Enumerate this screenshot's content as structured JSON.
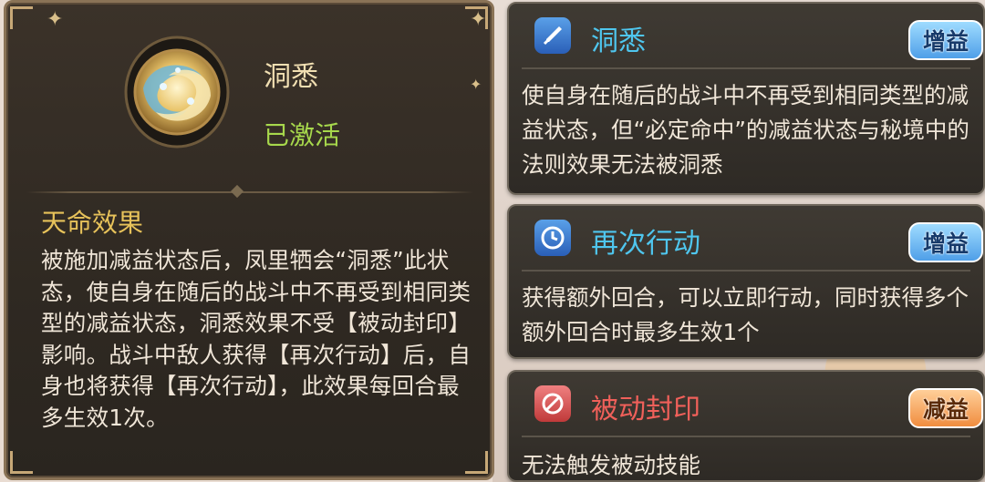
{
  "skill": {
    "name": "洞悉",
    "status": "已激活",
    "effect_title": "天命效果",
    "effect_text": "被施加减益状态后，凤里牺会“洞悉”此状态，使自身在随后的战斗中不再受到相同类型的减益状态，洞悉效果不受【被动封印】影响。战斗中敌人获得【再次行动】后，自身也将获得【再次行动】，此效果每回合最多生效1次。"
  },
  "cards": [
    {
      "name": "洞悉",
      "icon": "sword-icon",
      "tag": "增益",
      "tag_type": "buff",
      "text": "使自身在随后的战斗中不再受到相同类型的减益状态，但“必定命中”的减益状态与秘境中的法则效果无法被洞悉"
    },
    {
      "name": "再次行动",
      "icon": "clock-icon",
      "tag": "增益",
      "tag_type": "buff",
      "text": "获得额外回合，可以立即行动，同时获得多个额外回合时最多生效1个"
    },
    {
      "name": "被动封印",
      "icon": "seal-icon",
      "tag": "减益",
      "tag_type": "debuff",
      "text": "无法触发被动技能"
    }
  ],
  "colors": {
    "status_active": "#a7d84c",
    "effect_title": "#e7c25a",
    "buff_name": "#4fc6ee",
    "debuff_name": "#f0605a"
  }
}
